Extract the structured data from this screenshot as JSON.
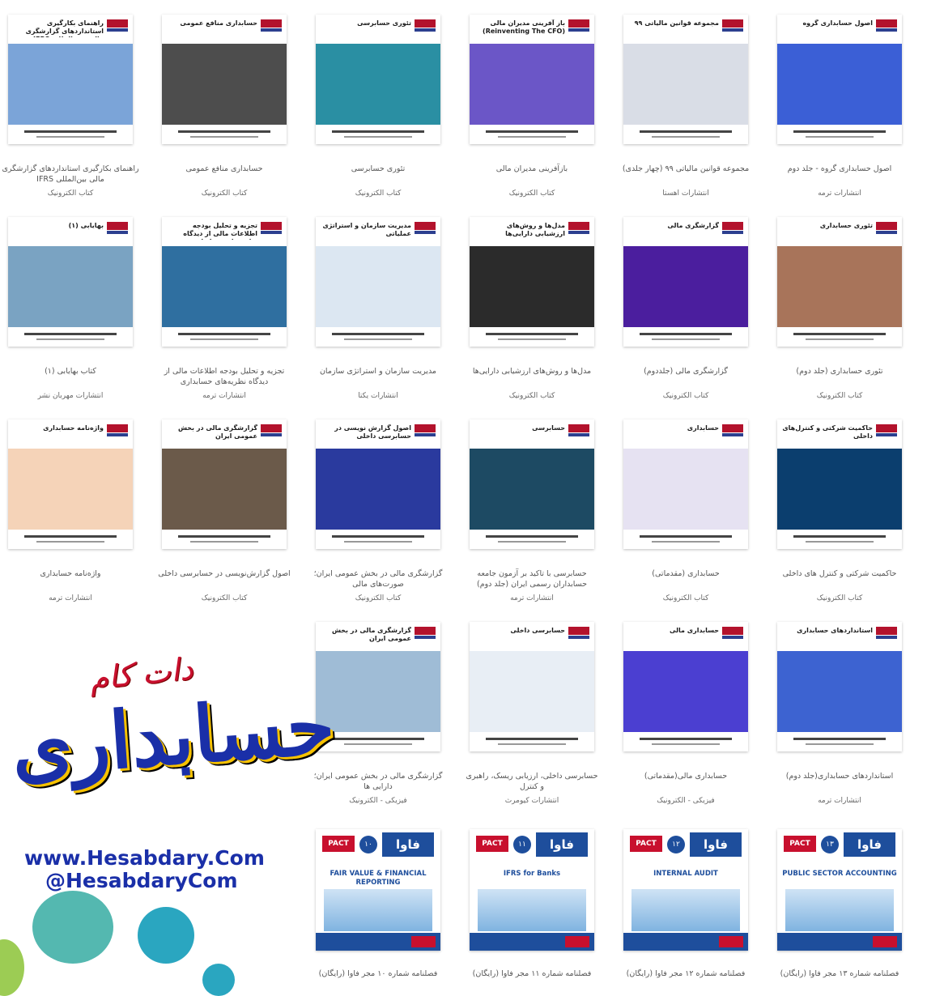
{
  "books": [
    {
      "cover_title": "اصول حسابداری گروه",
      "label": "اصول حسابداری گروه - جلد دوم",
      "publisher": "انتشارات ترمه",
      "art": "#3b5fd6"
    },
    {
      "cover_title": "مجموعه قوانین مالیاتی ۹۹",
      "label": "مجموعه قوانین مالیاتی ۹۹ (چهار جلدی)",
      "publisher": "انتشارات اهستا",
      "art": "#d9dde6"
    },
    {
      "cover_title": "باز آفرینی مدیران مالی (Reinventing The CFO)",
      "label": "بازآفرینی مدیران مالی",
      "publisher": "کتاب الکترونیک",
      "art": "#6b56c7"
    },
    {
      "cover_title": "تئوری حسابرسی",
      "label": "تئوری حسابرسی",
      "publisher": "کتاب الکترونیک",
      "art": "#2a8fa3"
    },
    {
      "cover_title": "حسابداری منافع عمومی",
      "label": "حسابداری منافع عمومی",
      "publisher": "کتاب الکترونیک",
      "art": "#4d4d4d"
    },
    {
      "cover_title": "راهنمای بکارگیری استانداردهای گزارشگری مالی بین المللی IFRS",
      "label": "راهنمای بکارگیری استانداردهای گزارشگری مالی بین‌المللی IFRS",
      "publisher": "کتاب الکترونیک",
      "art": "#7ba4d8"
    },
    {
      "cover_title": "تئوری حسابداری",
      "label": "تئوری حسابداری (جلد دوم)",
      "publisher": "کتاب الکترونیک",
      "art": "#a8745a"
    },
    {
      "cover_title": "گزارشگری مالی",
      "label": "گزارشگری مالی (جلددوم)",
      "publisher": "کتاب الکترونیک",
      "art": "#4b1e9e"
    },
    {
      "cover_title": "مدل‌ها و روش‌های ارزشیابی دارایی‌ها",
      "label": "مدل‌ها و روش‌های ارزشیابی دارایی‌ها",
      "publisher": "کتاب الکترونیک",
      "art": "#2b2b2b"
    },
    {
      "cover_title": "مدیریت سازمان و استراتژی عملیاتی",
      "label": "مدیریت سازمان و استراتژی سازمان",
      "publisher": "انتشارات یکتا",
      "art": "#dce7f2"
    },
    {
      "cover_title": "تجزیه و تحلیل بودجه اطلاعات مالی از دیدگاه نظریه‌های حسابداری",
      "label": "تجزیه و تحلیل بودجه اطلاعات مالی از دیدگاه نظریه‌های حسابداری",
      "publisher": "انتشارات ترمه",
      "art": "#2f6fa0"
    },
    {
      "cover_title": "بهایابی (۱)",
      "label": "کتاب بهایابی (۱)",
      "publisher": "انتشارات مهربان نشر",
      "art": "#7aa3c2"
    },
    {
      "cover_title": "حاکمیت شرکتی و کنترل‌های داخلی",
      "label": "حاکمیت شرکتی و کنترل های داخلی",
      "publisher": "کتاب الکترونیک",
      "art": "#0b3e6e"
    },
    {
      "cover_title": "حسابداری",
      "label": "حسابداری (مقدماتی)",
      "publisher": "کتاب الکترونیک",
      "art": "#e6e2f2"
    },
    {
      "cover_title": "حسابرسی",
      "label": "حسابرسی با تاکید بر آزمون جامعه حسابداران رسمی ایران (جلد دوم)",
      "publisher": "انتشارات ترمه",
      "art": "#1d4a63"
    },
    {
      "cover_title": "اصول گزارش نویسی در حسابرسی داخلی",
      "label": "گزارشگری مالی در بخش عمومی ایران؛ صورت‌های مالی",
      "publisher": "کتاب الکترونیک",
      "art": "#2a3a9e"
    },
    {
      "cover_title": "گزارشگری مالی در بخش عمومی ایران",
      "label": "اصول گزارش‌نویسی در حسابرسی داخلی",
      "publisher": "کتاب الکترونیک",
      "art": "#6b5a4a"
    },
    {
      "cover_title": "واژه‌نامه حسابداری",
      "label": "واژه‌نامه حسابداری",
      "publisher": "انتشارات ترمه",
      "art": "#f5d3b8"
    },
    {
      "cover_title": "استانداردهای حسابداری",
      "label": "استانداردهای حسابداری(جلد دوم)",
      "publisher": "انتشارات ترمه",
      "art": "#3d63d1"
    },
    {
      "cover_title": "حسابداری مالی",
      "label": "حسابداری مالی(مقدماتی)",
      "publisher": "فیزیکی - الکترونیک",
      "art": "#4b3fd1"
    },
    {
      "cover_title": "حسابرسی داخلی",
      "label": "حسابرسی داخلی، ارزیابی ریسک، راهبری و کنترل",
      "publisher": "انتشارات کیومرث",
      "art": "#e8eef5"
    },
    {
      "cover_title": "گزارشگری مالی در بخش عمومی ایران",
      "label": "گزارشگری مالی در بخش عمومی ایران؛ دارایی ها",
      "publisher": "فیزیکی - الکترونیک",
      "art": "#9fbcd6"
    }
  ],
  "fava": [
    {
      "pact": "PACT",
      "num": "۱۳",
      "name": "فاوا",
      "sub": "PUBLIC SECTOR ACCOUNTING",
      "label": "فصلنامه شماره ۱۳ مجر فاوا (رایگان)"
    },
    {
      "pact": "PACT",
      "num": "۱۲",
      "name": "فاوا",
      "sub": "INTERNAL AUDIT",
      "label": "فصلنامه شماره ۱۲ مجر فاوا (رایگان)"
    },
    {
      "pact": "PACT",
      "num": "۱۱",
      "name": "فاوا",
      "sub": "IFRS for Banks",
      "label": "فصلنامه شماره ۱۱ مجر فاوا (رایگان)"
    },
    {
      "pact": "PACT",
      "num": "۱۰",
      "name": "فاوا",
      "sub": "FAIR VALUE & FINANCIAL REPORTING",
      "label": "فصلنامه شماره ۱۰ مجر فاوا (رایگان)"
    }
  ],
  "brand": {
    "dotcom": "دات کام",
    "name": "حسابداری",
    "url": "www.Hesabdary.Com",
    "handle": "@HesabdaryCom"
  },
  "colors": {
    "accent": "#c8102e",
    "brand_blue": "#1a2fa8",
    "fava_blue": "#1e4e9c"
  }
}
